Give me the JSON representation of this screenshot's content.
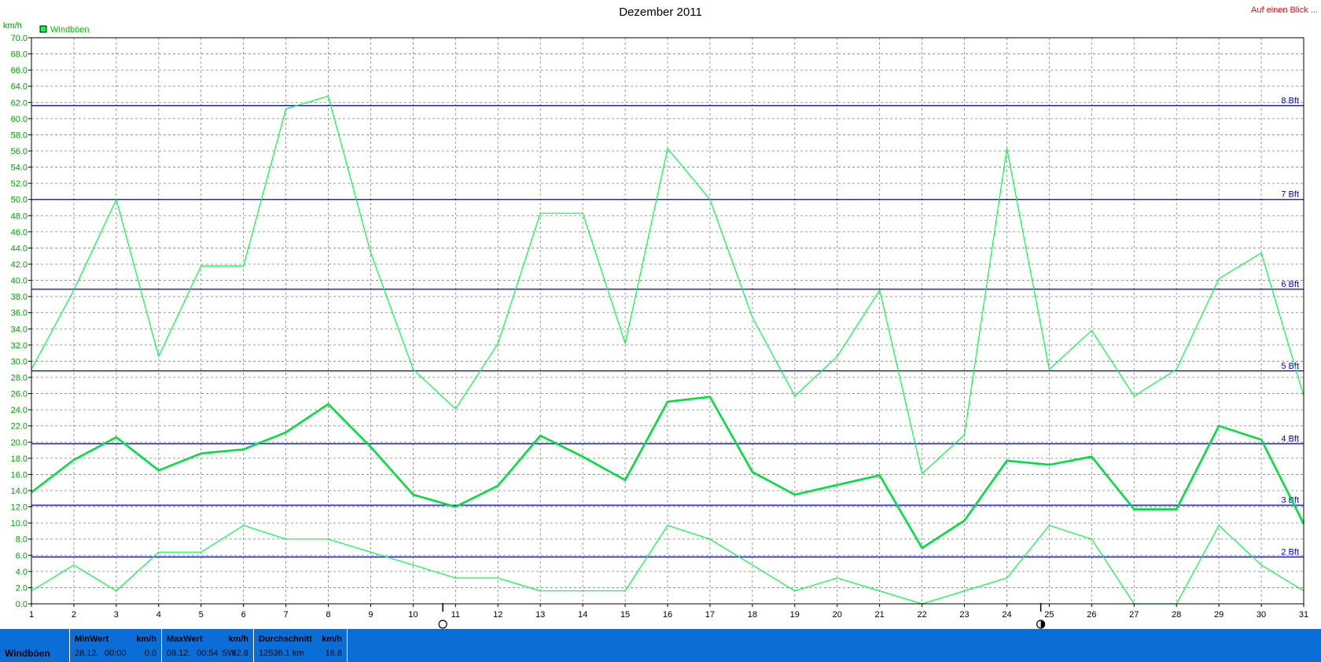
{
  "header": {
    "title": "Dezember 2011",
    "unit": "km/h",
    "at_a_glance": "Auf einen Blick ..."
  },
  "legend": {
    "label": "Windböen",
    "color": "#00ff40"
  },
  "chart_data": {
    "type": "line",
    "title": "Dezember 2011",
    "ylabel": "km/h",
    "xlabel": "",
    "ylim": [
      0,
      70
    ],
    "y_tick_step": 2,
    "x": [
      1,
      2,
      3,
      4,
      5,
      6,
      7,
      8,
      9,
      10,
      11,
      12,
      13,
      14,
      15,
      16,
      17,
      18,
      19,
      20,
      21,
      22,
      23,
      24,
      25,
      26,
      27,
      28,
      29,
      30,
      31
    ],
    "grid": true,
    "legend_position": "top-left",
    "series": [
      {
        "name": "Windböen",
        "role": "max",
        "color": "#00ff40",
        "values": [
          29.0,
          38.8,
          50.0,
          30.6,
          41.8,
          41.8,
          61.2,
          62.8,
          43.4,
          29.0,
          24.1,
          32.2,
          48.3,
          48.3,
          32.2,
          56.3,
          50.0,
          35.4,
          25.7,
          30.6,
          38.8,
          16.1,
          20.9,
          56.3,
          29.0,
          33.8,
          25.7,
          29.0,
          40.2,
          43.4,
          25.7
        ]
      },
      {
        "role": "avg",
        "color": "#00e03c",
        "values": [
          13.8,
          17.8,
          20.6,
          16.5,
          18.6,
          19.1,
          21.2,
          24.7,
          19.4,
          13.5,
          12.0,
          14.6,
          20.8,
          18.2,
          15.3,
          25.0,
          25.6,
          16.3,
          13.5,
          14.7,
          15.9,
          6.9,
          10.3,
          17.7,
          17.2,
          18.2,
          11.7,
          11.7,
          22.0,
          20.3,
          9.9
        ]
      },
      {
        "role": "min",
        "color": "#00ff40",
        "values": [
          1.6,
          4.8,
          1.6,
          6.4,
          6.4,
          9.7,
          8.0,
          8.0,
          6.4,
          4.8,
          3.2,
          3.2,
          1.6,
          1.6,
          1.6,
          9.7,
          8.0,
          4.8,
          1.6,
          3.2,
          1.6,
          0.0,
          1.6,
          3.2,
          9.7,
          8.0,
          0.0,
          0.0,
          9.7,
          4.8,
          1.6
        ]
      }
    ],
    "beaufort_lines": [
      {
        "label": "2 Bft",
        "value": 5.8
      },
      {
        "label": "3 Bft",
        "value": 12.2
      },
      {
        "label": "4 Bft",
        "value": 19.8
      },
      {
        "label": "5 Bft",
        "value": 28.8
      },
      {
        "label": "6 Bft",
        "value": 38.9
      },
      {
        "label": "7 Bft",
        "value": 50.0
      },
      {
        "label": "8 Bft",
        "value": 61.6
      }
    ],
    "moon_phases": [
      {
        "x": 10.7,
        "icon": "full-moon-icon"
      },
      {
        "x": 24.8,
        "icon": "first-quarter-moon-icon"
      }
    ],
    "colors": {
      "axis_ticks": "#00a000",
      "beaufort": "#0000cc",
      "grid": "#808080"
    }
  },
  "footer": {
    "row_label": "Windböen",
    "min": {
      "header": "MinWert",
      "unit": "km/h",
      "date": "28.12.",
      "time": "00:00",
      "value": "0.0"
    },
    "max": {
      "header": "MaxWert",
      "unit": "km/h",
      "date": "08.12.",
      "time": "00:54",
      "dir": "SW",
      "value": "62.8"
    },
    "avg": {
      "header": "Durchschnitt",
      "unit": "km/h",
      "distance": "12536.1 km",
      "value": "16.8"
    }
  }
}
